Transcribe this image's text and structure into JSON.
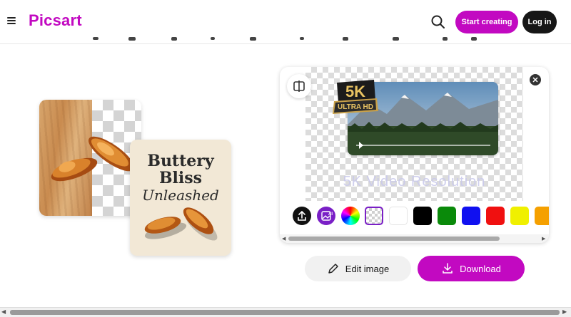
{
  "header": {
    "menu_icon": "hamburger-icon",
    "logo": "Picsart",
    "search_icon": "search-icon",
    "start_creating": "Start creating",
    "log_in": "Log in"
  },
  "left_preview": {
    "poster_line1": "Buttery",
    "poster_line2": "Bliss",
    "poster_line3": "Unleashed"
  },
  "editor": {
    "compare_icon": "compare-icon",
    "close_icon": "close-icon",
    "badge_top": "5K",
    "badge_bottom": "ULTRA HD",
    "watermark": "5K Video Resolution",
    "tools": [
      {
        "name": "upload-icon"
      },
      {
        "name": "ai-image-icon",
        "label": "AI"
      },
      {
        "name": "color-wheel-icon"
      }
    ],
    "swatches": [
      "transparent",
      "#ffffff",
      "#000000",
      "#0a8a0a",
      "#1010f0",
      "#f01010",
      "#f0f000",
      "#f5a000"
    ]
  },
  "actions": {
    "edit_image": "Edit image",
    "download": "Download"
  },
  "colors": {
    "brand": "#c209c1",
    "dark": "#161616"
  }
}
